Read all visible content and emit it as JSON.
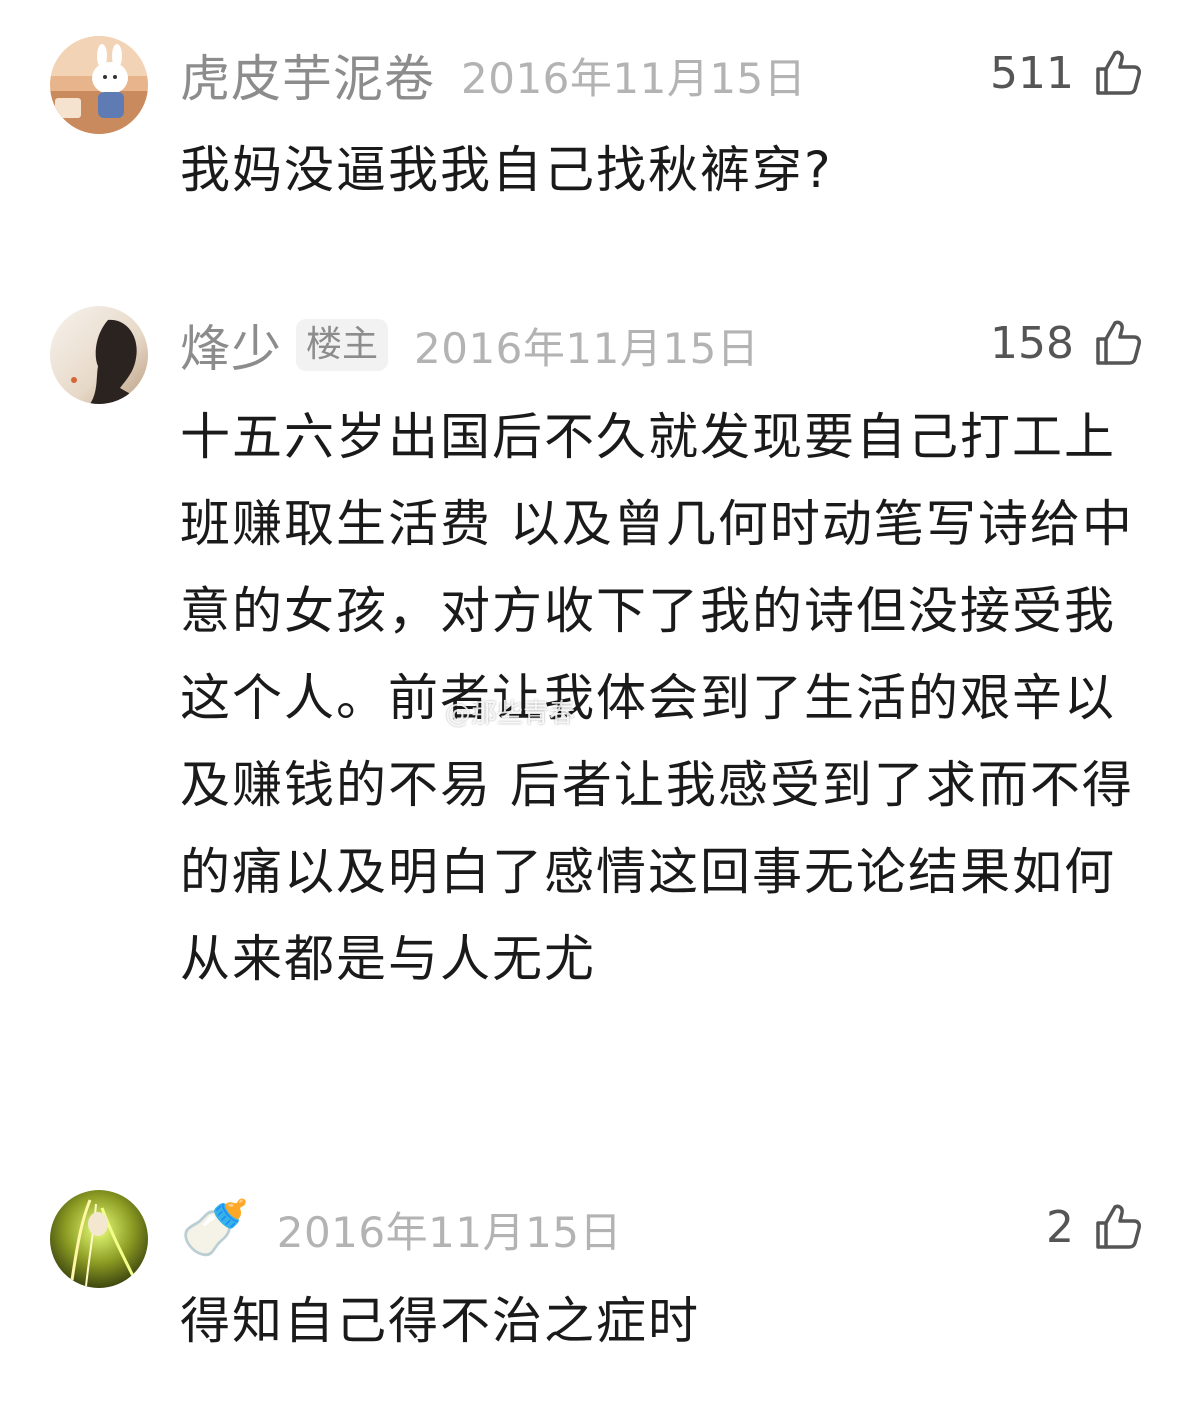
{
  "comments": [
    {
      "username": "虎皮芋泥卷",
      "badge": "",
      "date": "2016年11月15日",
      "likes": "511",
      "text": "我妈没逼我我自己找秋裤穿?"
    },
    {
      "username": "烽少",
      "badge": "楼主",
      "date": "2016年11月15日",
      "likes": "158",
      "text": "十五六岁出国后不久就发现要自己打工上班赚取生活费 以及曾几何时动笔写诗给中意的女孩，对方收下了我的诗但没接受我这个人。前者让我体会到了生活的艰辛以及赚钱的不易 后者让我感受到了求而不得的痛以及明白了感情这回事无论结果如何从来都是与人无尤"
    },
    {
      "username": "🍼",
      "badge": "",
      "date": "2016年11月15日",
      "likes": "2",
      "text": "得知自己得不治之症时"
    }
  ],
  "watermark": "@那些青春",
  "icons": {
    "like": "thumbs-up-icon"
  },
  "colors": {
    "username": "#8c8c8c",
    "date": "#b3b3b3",
    "body_text": "#1a1a1a",
    "badge_bg": "#f2f2f2"
  }
}
